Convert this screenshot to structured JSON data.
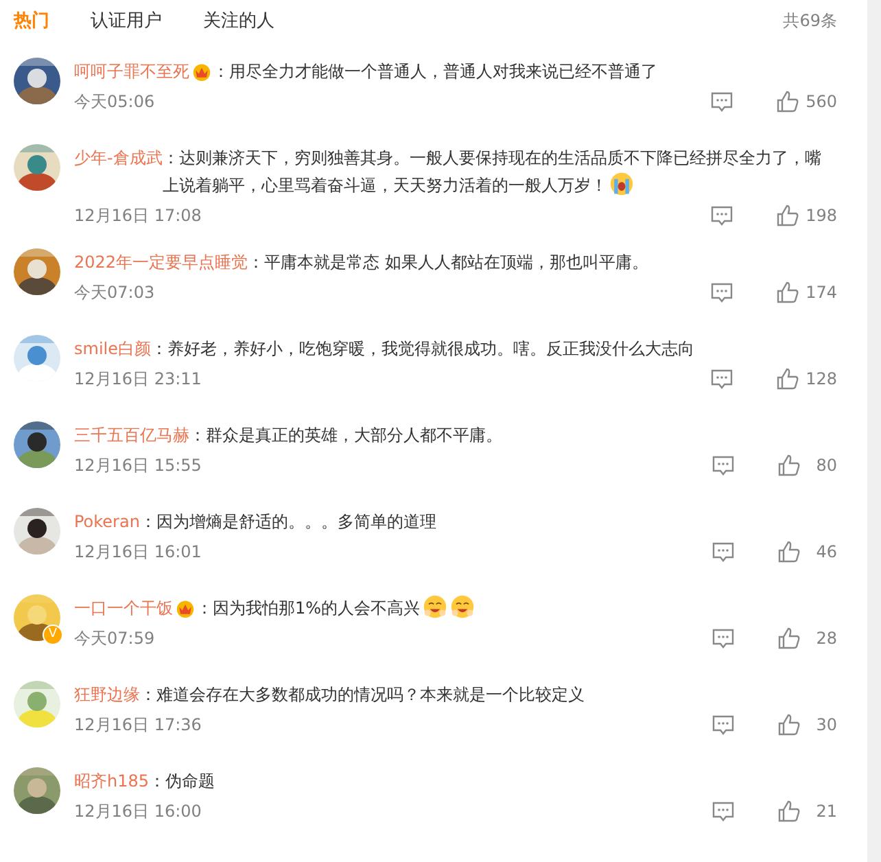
{
  "tabs": [
    {
      "label": "热门",
      "selected": true
    },
    {
      "label": "认证用户",
      "selected": false
    },
    {
      "label": "关注的人",
      "selected": false
    }
  ],
  "total": "共69条",
  "comments": [
    {
      "user": "呵呵子罪不至死",
      "vip": true,
      "text": "：用尽全力才能做一个普通人，普通人对我来说已经不普通了",
      "time": "今天05:06",
      "likes": "560"
    },
    {
      "user": "少年-倉成武",
      "vip": false,
      "text": "：达则兼济天下，穷则独善其身。一般人要保持现在的生活品质不下降已经拼尽全力了，嘴上说着躺平，心里骂着奋斗逼，天天努力活着的一般人万岁！",
      "emojis": [
        {
          "kind": "crying"
        }
      ],
      "time": "12月16日 17:08",
      "likes": "198"
    },
    {
      "user": "2022年一定要早点睡觉",
      "vip": false,
      "text": "：平庸本就是常态 如果人人都站在顶端，那也叫平庸。",
      "time": "今天07:03",
      "likes": "174"
    },
    {
      "user": "smile白颜",
      "vip": false,
      "text": "：养好老，养好小，吃饱穿暖，我觉得就很成功。嗐。反正我没什么大志向",
      "time": "12月16日 23:11",
      "likes": "128"
    },
    {
      "user": "三千五百亿马赫",
      "vip": false,
      "text": "：群众是真正的英雄，大部分人都不平庸。",
      "time": "12月16日 15:55",
      "likes": "80"
    },
    {
      "user": "Pokeran",
      "vip": false,
      "text": "：因为增熵是舒适的。。。多简单的道理",
      "time": "12月16日 16:01",
      "likes": "46"
    },
    {
      "user": "一口一个干饭",
      "vip": true,
      "verified": "V",
      "text": "：因为我怕那1%的人会不高兴",
      "emojis": [
        {
          "kind": "grin"
        },
        {
          "kind": "grin"
        }
      ],
      "time": "今天07:59",
      "likes": "28"
    },
    {
      "user": "狂野边缘",
      "vip": false,
      "text": "：难道会存在大多数都成功的情况吗？本来就是一个比较定义",
      "time": "12月16日 17:36",
      "likes": "30"
    },
    {
      "user": "昭齐h185",
      "vip": false,
      "text": "：伪命题",
      "time": "12月16日 16:00",
      "likes": "21"
    }
  ]
}
